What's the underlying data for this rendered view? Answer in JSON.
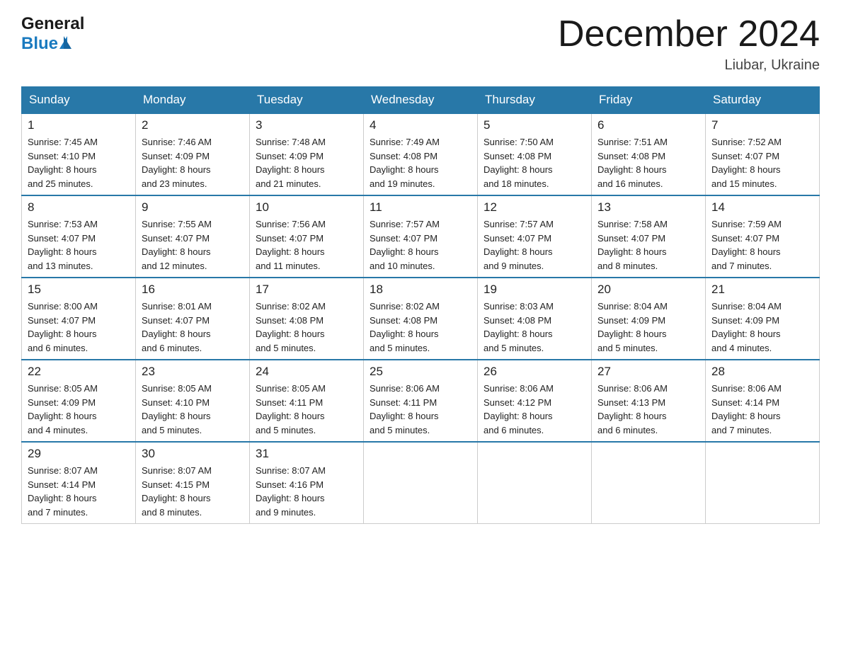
{
  "header": {
    "logo_general": "General",
    "logo_blue": "Blue",
    "month_title": "December 2024",
    "location": "Liubar, Ukraine"
  },
  "days_of_week": [
    "Sunday",
    "Monday",
    "Tuesday",
    "Wednesday",
    "Thursday",
    "Friday",
    "Saturday"
  ],
  "weeks": [
    [
      {
        "day": "1",
        "sunrise": "7:45 AM",
        "sunset": "4:10 PM",
        "daylight": "8 hours and 25 minutes."
      },
      {
        "day": "2",
        "sunrise": "7:46 AM",
        "sunset": "4:09 PM",
        "daylight": "8 hours and 23 minutes."
      },
      {
        "day": "3",
        "sunrise": "7:48 AM",
        "sunset": "4:09 PM",
        "daylight": "8 hours and 21 minutes."
      },
      {
        "day": "4",
        "sunrise": "7:49 AM",
        "sunset": "4:08 PM",
        "daylight": "8 hours and 19 minutes."
      },
      {
        "day": "5",
        "sunrise": "7:50 AM",
        "sunset": "4:08 PM",
        "daylight": "8 hours and 18 minutes."
      },
      {
        "day": "6",
        "sunrise": "7:51 AM",
        "sunset": "4:08 PM",
        "daylight": "8 hours and 16 minutes."
      },
      {
        "day": "7",
        "sunrise": "7:52 AM",
        "sunset": "4:07 PM",
        "daylight": "8 hours and 15 minutes."
      }
    ],
    [
      {
        "day": "8",
        "sunrise": "7:53 AM",
        "sunset": "4:07 PM",
        "daylight": "8 hours and 13 minutes."
      },
      {
        "day": "9",
        "sunrise": "7:55 AM",
        "sunset": "4:07 PM",
        "daylight": "8 hours and 12 minutes."
      },
      {
        "day": "10",
        "sunrise": "7:56 AM",
        "sunset": "4:07 PM",
        "daylight": "8 hours and 11 minutes."
      },
      {
        "day": "11",
        "sunrise": "7:57 AM",
        "sunset": "4:07 PM",
        "daylight": "8 hours and 10 minutes."
      },
      {
        "day": "12",
        "sunrise": "7:57 AM",
        "sunset": "4:07 PM",
        "daylight": "8 hours and 9 minutes."
      },
      {
        "day": "13",
        "sunrise": "7:58 AM",
        "sunset": "4:07 PM",
        "daylight": "8 hours and 8 minutes."
      },
      {
        "day": "14",
        "sunrise": "7:59 AM",
        "sunset": "4:07 PM",
        "daylight": "8 hours and 7 minutes."
      }
    ],
    [
      {
        "day": "15",
        "sunrise": "8:00 AM",
        "sunset": "4:07 PM",
        "daylight": "8 hours and 6 minutes."
      },
      {
        "day": "16",
        "sunrise": "8:01 AM",
        "sunset": "4:07 PM",
        "daylight": "8 hours and 6 minutes."
      },
      {
        "day": "17",
        "sunrise": "8:02 AM",
        "sunset": "4:08 PM",
        "daylight": "8 hours and 5 minutes."
      },
      {
        "day": "18",
        "sunrise": "8:02 AM",
        "sunset": "4:08 PM",
        "daylight": "8 hours and 5 minutes."
      },
      {
        "day": "19",
        "sunrise": "8:03 AM",
        "sunset": "4:08 PM",
        "daylight": "8 hours and 5 minutes."
      },
      {
        "day": "20",
        "sunrise": "8:04 AM",
        "sunset": "4:09 PM",
        "daylight": "8 hours and 5 minutes."
      },
      {
        "day": "21",
        "sunrise": "8:04 AM",
        "sunset": "4:09 PM",
        "daylight": "8 hours and 4 minutes."
      }
    ],
    [
      {
        "day": "22",
        "sunrise": "8:05 AM",
        "sunset": "4:09 PM",
        "daylight": "8 hours and 4 minutes."
      },
      {
        "day": "23",
        "sunrise": "8:05 AM",
        "sunset": "4:10 PM",
        "daylight": "8 hours and 5 minutes."
      },
      {
        "day": "24",
        "sunrise": "8:05 AM",
        "sunset": "4:11 PM",
        "daylight": "8 hours and 5 minutes."
      },
      {
        "day": "25",
        "sunrise": "8:06 AM",
        "sunset": "4:11 PM",
        "daylight": "8 hours and 5 minutes."
      },
      {
        "day": "26",
        "sunrise": "8:06 AM",
        "sunset": "4:12 PM",
        "daylight": "8 hours and 6 minutes."
      },
      {
        "day": "27",
        "sunrise": "8:06 AM",
        "sunset": "4:13 PM",
        "daylight": "8 hours and 6 minutes."
      },
      {
        "day": "28",
        "sunrise": "8:06 AM",
        "sunset": "4:14 PM",
        "daylight": "8 hours and 7 minutes."
      }
    ],
    [
      {
        "day": "29",
        "sunrise": "8:07 AM",
        "sunset": "4:14 PM",
        "daylight": "8 hours and 7 minutes."
      },
      {
        "day": "30",
        "sunrise": "8:07 AM",
        "sunset": "4:15 PM",
        "daylight": "8 hours and 8 minutes."
      },
      {
        "day": "31",
        "sunrise": "8:07 AM",
        "sunset": "4:16 PM",
        "daylight": "8 hours and 9 minutes."
      },
      null,
      null,
      null,
      null
    ]
  ],
  "labels": {
    "sunrise": "Sunrise:",
    "sunset": "Sunset:",
    "daylight": "Daylight:"
  }
}
